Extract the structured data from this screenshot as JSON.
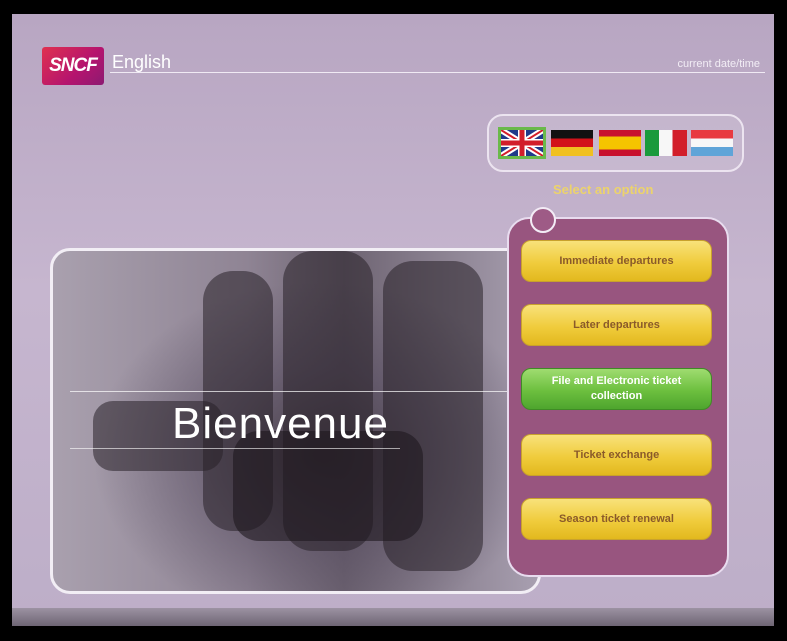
{
  "header": {
    "logo_text": "SNCF",
    "language": "English",
    "datetime": "current date/time"
  },
  "languages": [
    {
      "name": "uk-flag-icon",
      "selected": true
    },
    {
      "name": "germany-flag-icon",
      "selected": false
    },
    {
      "name": "spain-flag-icon",
      "selected": false
    },
    {
      "name": "italy-flag-icon",
      "selected": false
    },
    {
      "name": "luxembourg-flag-icon",
      "selected": false
    }
  ],
  "menu": {
    "prompt": "Select an option",
    "options": [
      {
        "label": "Immediate departures",
        "active": false
      },
      {
        "label": "Later departures",
        "active": false
      },
      {
        "label": "File and Electronic ticket collection",
        "active": true
      },
      {
        "label": "Ticket exchange",
        "active": false
      },
      {
        "label": "Season ticket renewal",
        "active": false
      }
    ]
  },
  "welcome": {
    "text": "Bienvenue"
  },
  "colors": {
    "background": "#c0b1ca",
    "menu_panel": "#98557f",
    "button_yellow": "#f0cc3c",
    "button_active_green": "#6cbf3e",
    "brand_pink": "#c3196a"
  }
}
